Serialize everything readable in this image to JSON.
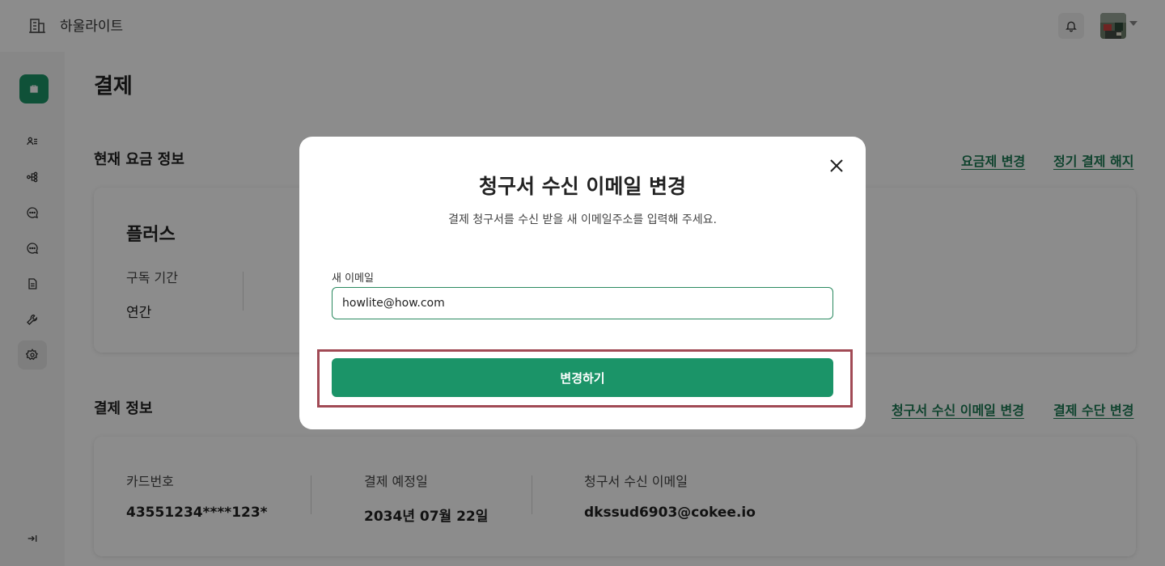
{
  "app": {
    "name": "하울라이트",
    "brand_icon": "building-icon"
  },
  "header": {
    "bell_icon": "bell-icon",
    "avatar_icon": "avatar",
    "caret_icon": "chevron-down-icon"
  },
  "sidebar": {
    "home_icon": "briefcase-icon",
    "items": [
      {
        "icon": "user-list-icon",
        "active": false
      },
      {
        "icon": "org-chart-icon",
        "active": false
      },
      {
        "icon": "chat-bubble-icon",
        "active": false
      },
      {
        "icon": "chat-bubble-alt-icon",
        "active": false
      },
      {
        "icon": "document-icon",
        "active": false
      },
      {
        "icon": "wrench-icon",
        "active": false
      },
      {
        "icon": "gear-icon",
        "active": true
      }
    ],
    "collapse_icon": "collapse-arrow-icon"
  },
  "page": {
    "title": "결제"
  },
  "current_plan": {
    "section_title": "현재 요금 정보",
    "change_plan_link": "요금제 변경",
    "cancel_link": "정기 결제 해지",
    "plan_name": "플러스",
    "period_label": "구독 기간",
    "period_value": "연간"
  },
  "payment_info": {
    "section_title": "결제 정보",
    "change_email_link": "청구서 수신 이메일 변경",
    "change_method_link": "결제 수단 변경",
    "card_label": "카드번호",
    "card_value": "43551234****123*",
    "due_label": "결제 예정일",
    "due_value": "2034년 07월 22일",
    "email_label": "청구서 수신 이메일",
    "email_value": "dkssud6903@cokee.io"
  },
  "modal": {
    "title": "청구서 수신 이메일 변경",
    "subtitle": "결제 청구서를 수신 받을 새 이메일주소를 입력해 주세요.",
    "input_label": "새 이메일",
    "input_value": "howlite@how.com",
    "submit_label": "변경하기",
    "close_icon": "close-icon"
  },
  "colors": {
    "accent": "#1b9468",
    "link": "#1d7a55",
    "highlight": "#a14a55"
  }
}
